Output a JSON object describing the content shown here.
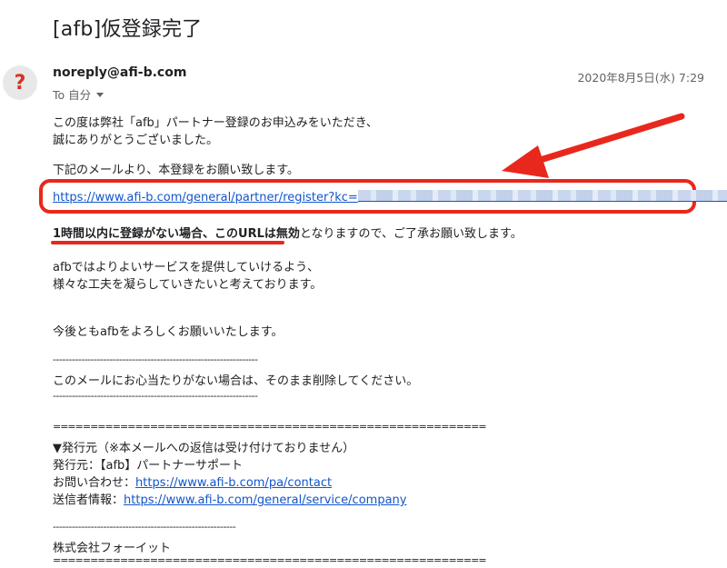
{
  "subject": "[afb]仮登録完了",
  "avatar": "?",
  "sender": "noreply@afi-b.com",
  "recipient": "To 自分",
  "date": "2020年8月5日(水) 7:29",
  "body": {
    "line1": "この度は弊社「afb」パートナー登録のお申込みをいただき、",
    "line2": "誠にありがとうございました。",
    "line3": "下記のメールより、本登録をお願い致します。",
    "register_url": "https://www.afi-b.com/general/partner/register?kc=",
    "notice_bold": "1時間以内に登録がない場合、このURLは無効",
    "notice_rest": "となりますので、ご了承お願い致します。",
    "line5": "afbではよりよいサービスを提供していけるよう、",
    "line6": "様々な工夫を凝らしていきたいと考えております。",
    "line7": "今後ともafbをよろしくお願いいたします。",
    "dash1": "-----------------------------------------------------------------",
    "line8": "このメールにお心当たりがない場合は、そのまま削除してください。",
    "dash2": "-----------------------------------------------------------------",
    "eq1": "==========================================================",
    "issuer_header": "▼発行元（※本メールへの返信は受け付けておりません）",
    "issuer": "発行元：【afb】パートナーサポート",
    "contact_label": "お問い合わせ：",
    "contact_url": "https://www.afi-b.com/pa/contact",
    "sender_info_label": "送信者情報：",
    "sender_info_url": "https://www.afi-b.com/general/service/company",
    "dash3": "----------------------------------------------------------",
    "company": "株式会社フォーイット",
    "eq2": "=========================================================="
  },
  "colors": {
    "annotation_red": "#e8281c",
    "link_blue": "#1155cc",
    "avatar_mark": "#d93025"
  }
}
